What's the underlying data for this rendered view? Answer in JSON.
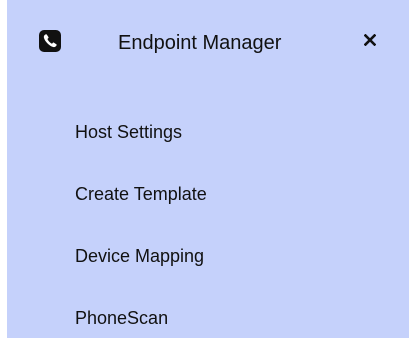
{
  "panel": {
    "title": "Endpoint Manager",
    "background": "#c5d1fb",
    "icons": {
      "header": "phone-icon",
      "close": "close-icon"
    }
  },
  "menu": {
    "items": [
      {
        "label": "Host Settings"
      },
      {
        "label": "Create Template"
      },
      {
        "label": "Device Mapping"
      },
      {
        "label": "PhoneScan"
      }
    ]
  }
}
